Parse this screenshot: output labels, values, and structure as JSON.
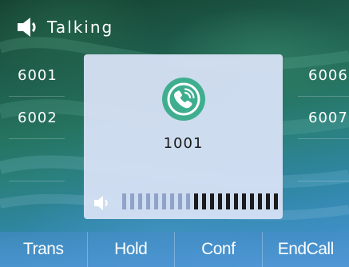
{
  "header": {
    "icon": "speaker-icon",
    "title": "Talking"
  },
  "lines": {
    "left": [
      {
        "label": "6001"
      },
      {
        "label": "6002"
      },
      {
        "label": ""
      },
      {
        "label": ""
      }
    ],
    "right": [
      {
        "label": "6006"
      },
      {
        "label": "6007"
      },
      {
        "label": ""
      },
      {
        "label": ""
      }
    ]
  },
  "call": {
    "icon": "phone-handset-icon",
    "icon_color": "#3fae8f",
    "number": "1001",
    "volume": {
      "icon": "volume-icon",
      "level": 11,
      "max": 20,
      "active_color": "#1b1b1b",
      "inactive_color": "#8fa3c9"
    }
  },
  "softkeys": [
    {
      "label": "Trans"
    },
    {
      "label": "Hold"
    },
    {
      "label": "Conf"
    },
    {
      "label": "EndCall"
    }
  ]
}
